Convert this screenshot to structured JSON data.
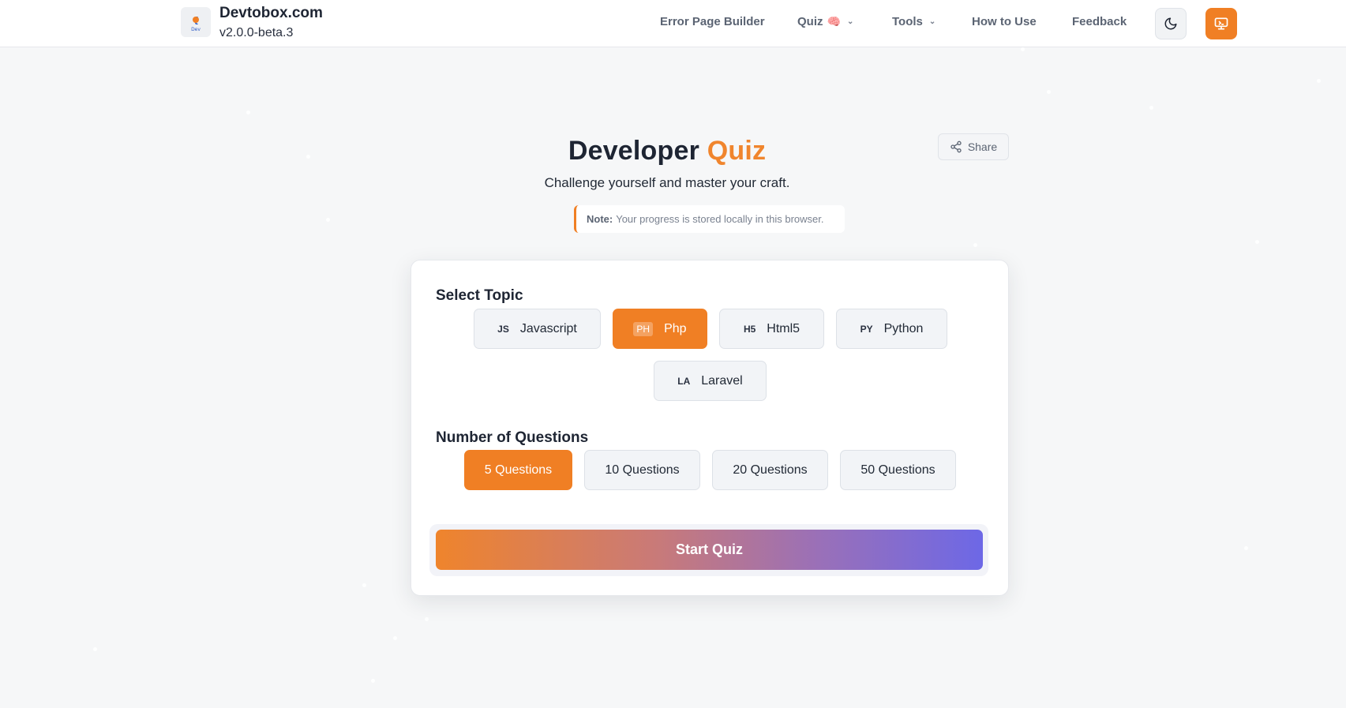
{
  "header": {
    "brand_name": "Devtobox.com",
    "version": "v2.0.0-beta.3",
    "logo_text": "{⚙}",
    "nav": [
      {
        "label": "Error Page Builder"
      },
      {
        "label": "Quiz",
        "emoji": "🧠"
      },
      {
        "label": "Tools"
      },
      {
        "label": "How to Use"
      },
      {
        "label": "Feedback"
      }
    ]
  },
  "hero": {
    "title_main": "Developer",
    "title_accent": "Quiz",
    "subtitle": "Challenge yourself and master your craft.",
    "note_label": "Note:",
    "note_text": "Your progress is stored locally in this browser.",
    "share_label": "Share"
  },
  "quiz_setup": {
    "topic_heading": "Select Topic",
    "topics": [
      {
        "abbr": "JS",
        "label": "Javascript",
        "selected": false
      },
      {
        "abbr": "PH",
        "label": "Php",
        "selected": true
      },
      {
        "abbr": "H5",
        "label": "Html5",
        "selected": false
      },
      {
        "abbr": "PY",
        "label": "Python",
        "selected": false
      },
      {
        "abbr": "LA",
        "label": "Laravel",
        "selected": false
      }
    ],
    "count_heading": "Number of Questions",
    "counts": [
      {
        "label": "5 Questions",
        "selected": true
      },
      {
        "label": "10 Questions",
        "selected": false
      },
      {
        "label": "20 Questions",
        "selected": false
      },
      {
        "label": "50 Questions",
        "selected": false
      }
    ],
    "start_label": "Start Quiz"
  },
  "colors": {
    "accent": "#f07f24",
    "gradient_end": "#6d68e6",
    "background": "#f6f7f8"
  }
}
